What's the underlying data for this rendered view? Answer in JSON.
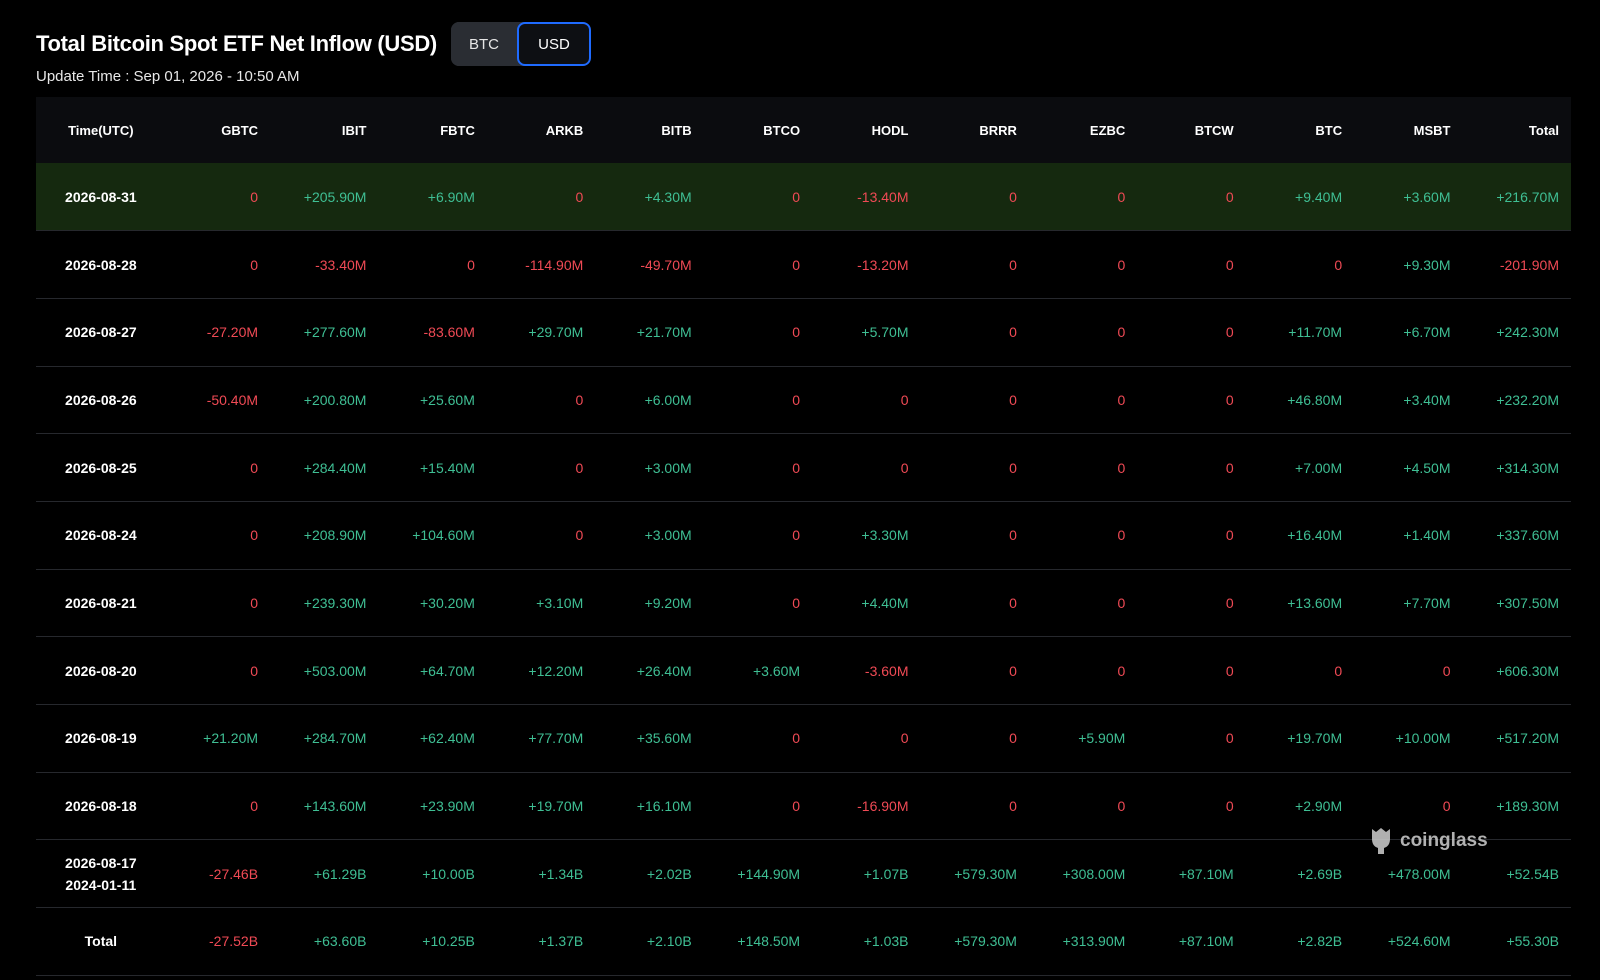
{
  "header": {
    "title": "Total Bitcoin Spot ETF Net Inflow (USD)",
    "toggle": [
      {
        "label": "BTC",
        "active": false
      },
      {
        "label": "USD",
        "active": true
      }
    ],
    "update_time": "Update Time : Sep 01, 2026 - 10:50 AM"
  },
  "table": {
    "columns": [
      "Time(UTC)",
      "GBTC",
      "IBIT",
      "FBTC",
      "ARKB",
      "BITB",
      "BTCO",
      "HODL",
      "BRRR",
      "EZBC",
      "BTCW",
      "BTC",
      "MSBT",
      "Total"
    ],
    "rows": [
      {
        "date": "2026-08-31",
        "date2": "",
        "highlight": true,
        "values": [
          "0",
          "+205.90M",
          "+6.90M",
          "0",
          "+4.30M",
          "0",
          "-13.40M",
          "0",
          "0",
          "0",
          "+9.40M",
          "+3.60M",
          "+216.70M"
        ]
      },
      {
        "date": "2026-08-28",
        "date2": "",
        "highlight": false,
        "values": [
          "0",
          "-33.40M",
          "0",
          "-114.90M",
          "-49.70M",
          "0",
          "-13.20M",
          "0",
          "0",
          "0",
          "0",
          "+9.30M",
          "-201.90M"
        ]
      },
      {
        "date": "2026-08-27",
        "date2": "",
        "highlight": false,
        "values": [
          "-27.20M",
          "+277.60M",
          "-83.60M",
          "+29.70M",
          "+21.70M",
          "0",
          "+5.70M",
          "0",
          "0",
          "0",
          "+11.70M",
          "+6.70M",
          "+242.30M"
        ]
      },
      {
        "date": "2026-08-26",
        "date2": "",
        "highlight": false,
        "values": [
          "-50.40M",
          "+200.80M",
          "+25.60M",
          "0",
          "+6.00M",
          "0",
          "0",
          "0",
          "0",
          "0",
          "+46.80M",
          "+3.40M",
          "+232.20M"
        ]
      },
      {
        "date": "2026-08-25",
        "date2": "",
        "highlight": false,
        "values": [
          "0",
          "+284.40M",
          "+15.40M",
          "0",
          "+3.00M",
          "0",
          "0",
          "0",
          "0",
          "0",
          "+7.00M",
          "+4.50M",
          "+314.30M"
        ]
      },
      {
        "date": "2026-08-24",
        "date2": "",
        "highlight": false,
        "values": [
          "0",
          "+208.90M",
          "+104.60M",
          "0",
          "+3.00M",
          "0",
          "+3.30M",
          "0",
          "0",
          "0",
          "+16.40M",
          "+1.40M",
          "+337.60M"
        ]
      },
      {
        "date": "2026-08-21",
        "date2": "",
        "highlight": false,
        "values": [
          "0",
          "+239.30M",
          "+30.20M",
          "+3.10M",
          "+9.20M",
          "0",
          "+4.40M",
          "0",
          "0",
          "0",
          "+13.60M",
          "+7.70M",
          "+307.50M"
        ]
      },
      {
        "date": "2026-08-20",
        "date2": "",
        "highlight": false,
        "values": [
          "0",
          "+503.00M",
          "+64.70M",
          "+12.20M",
          "+26.40M",
          "+3.60M",
          "-3.60M",
          "0",
          "0",
          "0",
          "0",
          "0",
          "+606.30M"
        ]
      },
      {
        "date": "2026-08-19",
        "date2": "",
        "highlight": false,
        "values": [
          "+21.20M",
          "+284.70M",
          "+62.40M",
          "+77.70M",
          "+35.60M",
          "0",
          "0",
          "0",
          "+5.90M",
          "0",
          "+19.70M",
          "+10.00M",
          "+517.20M"
        ]
      },
      {
        "date": "2026-08-18",
        "date2": "",
        "highlight": false,
        "values": [
          "0",
          "+143.60M",
          "+23.90M",
          "+19.70M",
          "+16.10M",
          "0",
          "-16.90M",
          "0",
          "0",
          "0",
          "+2.90M",
          "0",
          "+189.30M"
        ]
      },
      {
        "date": "2026-08-17",
        "date2": "2024-01-11",
        "highlight": false,
        "values": [
          "-27.46B",
          "+61.29B",
          "+10.00B",
          "+1.34B",
          "+2.02B",
          "+144.90M",
          "+1.07B",
          "+579.30M",
          "+308.00M",
          "+87.10M",
          "+2.69B",
          "+478.00M",
          "+52.54B"
        ]
      },
      {
        "date": "Total",
        "date2": "",
        "highlight": false,
        "values": [
          "-27.52B",
          "+63.60B",
          "+10.25B",
          "+1.37B",
          "+2.10B",
          "+148.50M",
          "+1.03B",
          "+579.30M",
          "+313.90M",
          "+87.10M",
          "+2.82B",
          "+524.60M",
          "+55.30B"
        ]
      }
    ]
  },
  "watermark": {
    "text": "coinglass",
    "icon": "coinglass-logo-icon"
  },
  "colors": {
    "positive": "#3fbf94",
    "negative": "#f04a55",
    "highlight_row": "#15290f",
    "active_toggle_border": "#1f6bff"
  }
}
